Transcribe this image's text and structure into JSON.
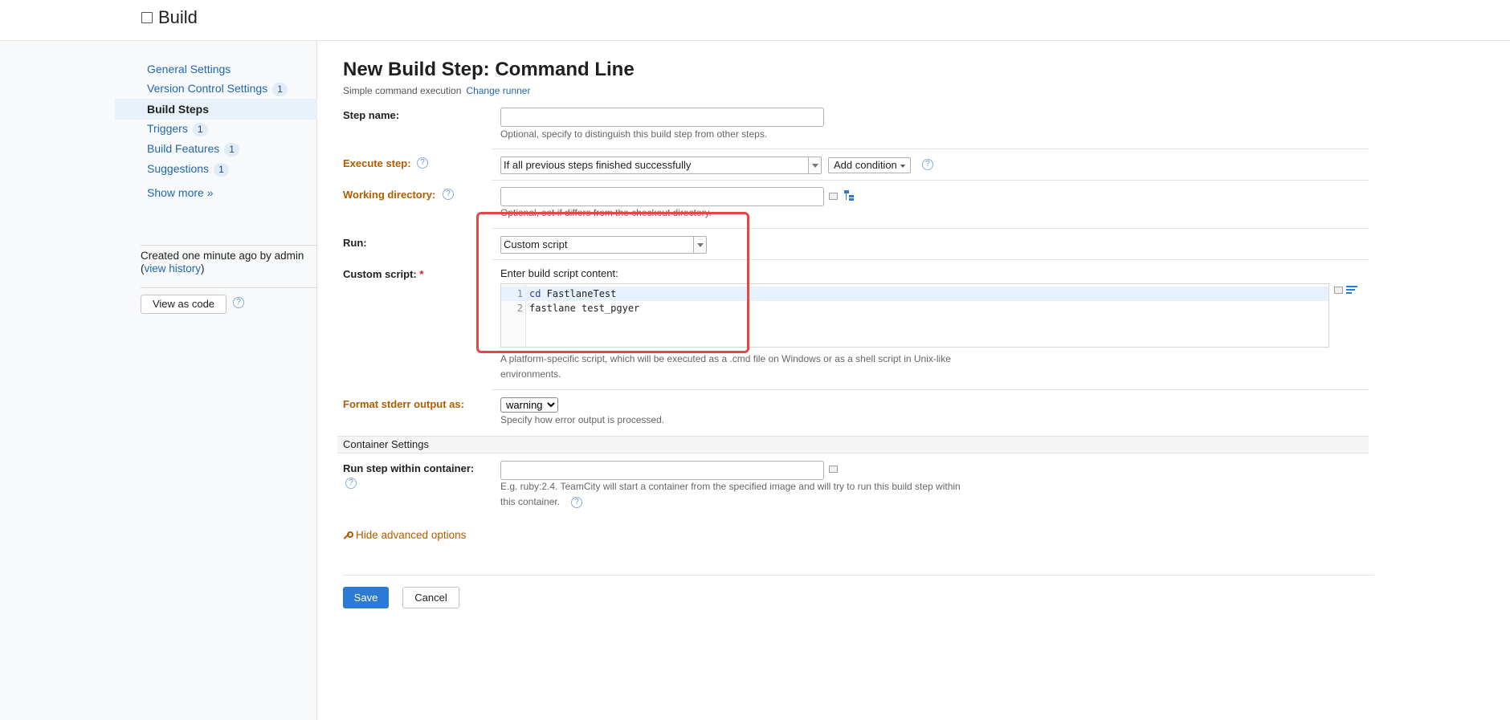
{
  "header": {
    "title": "Build"
  },
  "sidebar": {
    "items": [
      {
        "label": "General Settings",
        "badge": ""
      },
      {
        "label": "Version Control Settings",
        "badge": "1"
      },
      {
        "label": "Build Steps",
        "badge": "",
        "active": true
      },
      {
        "label": "Triggers",
        "badge": "1"
      },
      {
        "label": "Build Features",
        "badge": "1"
      },
      {
        "label": "Suggestions",
        "badge": "1"
      }
    ],
    "show_more": "Show more »",
    "created_text": "Created one minute ago by admin",
    "view_history_link": "view history",
    "view_as_code": "View as code"
  },
  "page": {
    "title": "New Build Step: Command Line",
    "subtitle": "Simple command execution",
    "change_runner": "Change runner"
  },
  "form": {
    "step_name": {
      "label": "Step name:",
      "value": "",
      "hint": "Optional, specify to distinguish this build step from other steps."
    },
    "execute_step": {
      "label": "Execute step:",
      "value": "If all previous steps finished successfully",
      "add_condition": "Add condition"
    },
    "working_directory": {
      "label": "Working directory:",
      "value": "",
      "hint": "Optional, set if differs from the checkout directory."
    },
    "run": {
      "label": "Run:",
      "value": "Custom script"
    },
    "custom_script": {
      "label": "Custom script:",
      "required_mark": "*",
      "prompt": "Enter build script content:",
      "lines": [
        {
          "num": "1",
          "keyword": "cd",
          "rest": " FastlaneTest"
        },
        {
          "num": "2",
          "keyword": "",
          "rest": "fastlane test_pgyer"
        }
      ],
      "hint_line1": "A platform-specific script, which will be executed as a .cmd file on Windows or as a shell script in Unix-like",
      "hint_line2": "environments."
    },
    "format_stderr": {
      "label": "Format stderr output as:",
      "value": "warning",
      "hint": "Specify how error output is processed."
    },
    "container_section": "Container Settings",
    "container": {
      "label": "Run step within container:",
      "value": "",
      "hint_line1": "E.g. ruby:2.4. TeamCity will start a container from the specified image and will try to run this build step within",
      "hint_line2": "this container."
    },
    "hide_advanced": "Hide advanced options"
  },
  "buttons": {
    "save": "Save",
    "cancel": "Cancel"
  },
  "colors": {
    "accent": "#2a7ad6",
    "link": "#1f67b1",
    "warning_label": "#b25c00",
    "highlight": "#e84545"
  }
}
